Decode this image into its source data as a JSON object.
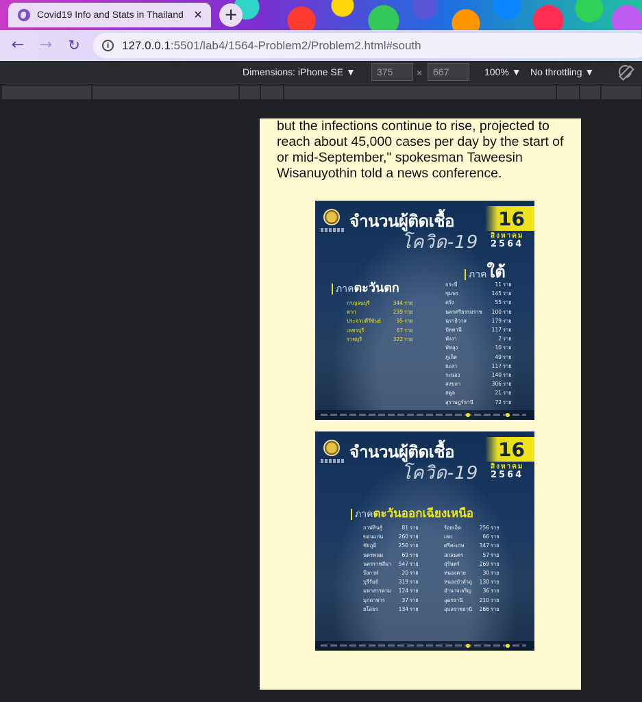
{
  "browser": {
    "tab_title": "Covid19 Info and Stats in Thailand",
    "url_host": "127.0.0.1",
    "url_path": ":5501/lab4/1564-Problem2/Problem2.html#south"
  },
  "devtools": {
    "dimensions_label": "Dimensions: iPhone SE ▼",
    "width_value": "375",
    "height_value": "667",
    "times": "×",
    "zoom_label": "100% ▼",
    "throttle_label": "No throttling ▼"
  },
  "article": {
    "paragraph": "but the infections continue to rise, projected to reach about 45,000 cases per day by the start of or mid-September,\" spokesman Taweesin Wisanuyothin told a news conference."
  },
  "infographic_1": {
    "title": "จำนวนผู้ติดเชื้อ",
    "subtitle": "โควิด-19",
    "day": "16",
    "month": "สิงหาคม",
    "year": "2564",
    "region_prefix": "ภาค",
    "west_name": "ตะวันตก",
    "south_name": "ใต้",
    "unit": "ราย",
    "west": [
      {
        "prov": "กาญจนบุรี",
        "num": "344"
      },
      {
        "prov": "ตาก",
        "num": "239"
      },
      {
        "prov": "ประจวบคีรีขันธ์",
        "num": "95"
      },
      {
        "prov": "เพชรบุรี",
        "num": "67"
      },
      {
        "prov": "ราชบุรี",
        "num": "322"
      }
    ],
    "south": [
      {
        "prov": "กระบี่",
        "num": "11"
      },
      {
        "prov": "ชุมพร",
        "num": "145"
      },
      {
        "prov": "ตรัง",
        "num": "55"
      },
      {
        "prov": "นครศรีธรรมราช",
        "num": "100"
      },
      {
        "prov": "นราธิวาส",
        "num": "179"
      },
      {
        "prov": "ปัตตานี",
        "num": "117"
      },
      {
        "prov": "พังงา",
        "num": "2"
      },
      {
        "prov": "พัทลุง",
        "num": "10"
      },
      {
        "prov": "ภูเก็ต",
        "num": "49"
      },
      {
        "prov": "ยะลา",
        "num": "117"
      },
      {
        "prov": "ระนอง",
        "num": "140"
      },
      {
        "prov": "สงขลา",
        "num": "306"
      },
      {
        "prov": "สตูล",
        "num": "21"
      },
      {
        "prov": "สุราษฎร์ธานี",
        "num": "72"
      }
    ]
  },
  "infographic_2": {
    "title": "จำนวนผู้ติดเชื้อ",
    "subtitle": "โควิด-19",
    "day": "16",
    "month": "สิงหาคม",
    "year": "2564",
    "region_prefix": "ภาค",
    "region_name": "ตะวันออกเฉียงเหนือ",
    "unit": "ราย",
    "col1": [
      {
        "prov": "กาฬสินธุ์",
        "num": "81"
      },
      {
        "prov": "ขอนแก่น",
        "num": "260"
      },
      {
        "prov": "ชัยภูมิ",
        "num": "250"
      },
      {
        "prov": "นครพนม",
        "num": "69"
      },
      {
        "prov": "นครราชสีมา",
        "num": "547"
      },
      {
        "prov": "บึงกาฬ",
        "num": "20"
      },
      {
        "prov": "บุรีรัมย์",
        "num": "319"
      },
      {
        "prov": "มหาสารคาม",
        "num": "124"
      },
      {
        "prov": "มุกดาหาร",
        "num": "37"
      },
      {
        "prov": "ยโสธร",
        "num": "134"
      }
    ],
    "col2": [
      {
        "prov": "ร้อยเอ็ด",
        "num": "256"
      },
      {
        "prov": "เลย",
        "num": "66"
      },
      {
        "prov": "ศรีสะเกษ",
        "num": "347"
      },
      {
        "prov": "สกลนคร",
        "num": "57"
      },
      {
        "prov": "สุรินทร์",
        "num": "269"
      },
      {
        "prov": "หนองคาย",
        "num": "30"
      },
      {
        "prov": "หนองบัวลำภู",
        "num": "130"
      },
      {
        "prov": "อำนาจเจริญ",
        "num": "36"
      },
      {
        "prov": "อุดรธานี",
        "num": "210"
      },
      {
        "prov": "อุบลราชธานี",
        "num": "266"
      }
    ]
  }
}
